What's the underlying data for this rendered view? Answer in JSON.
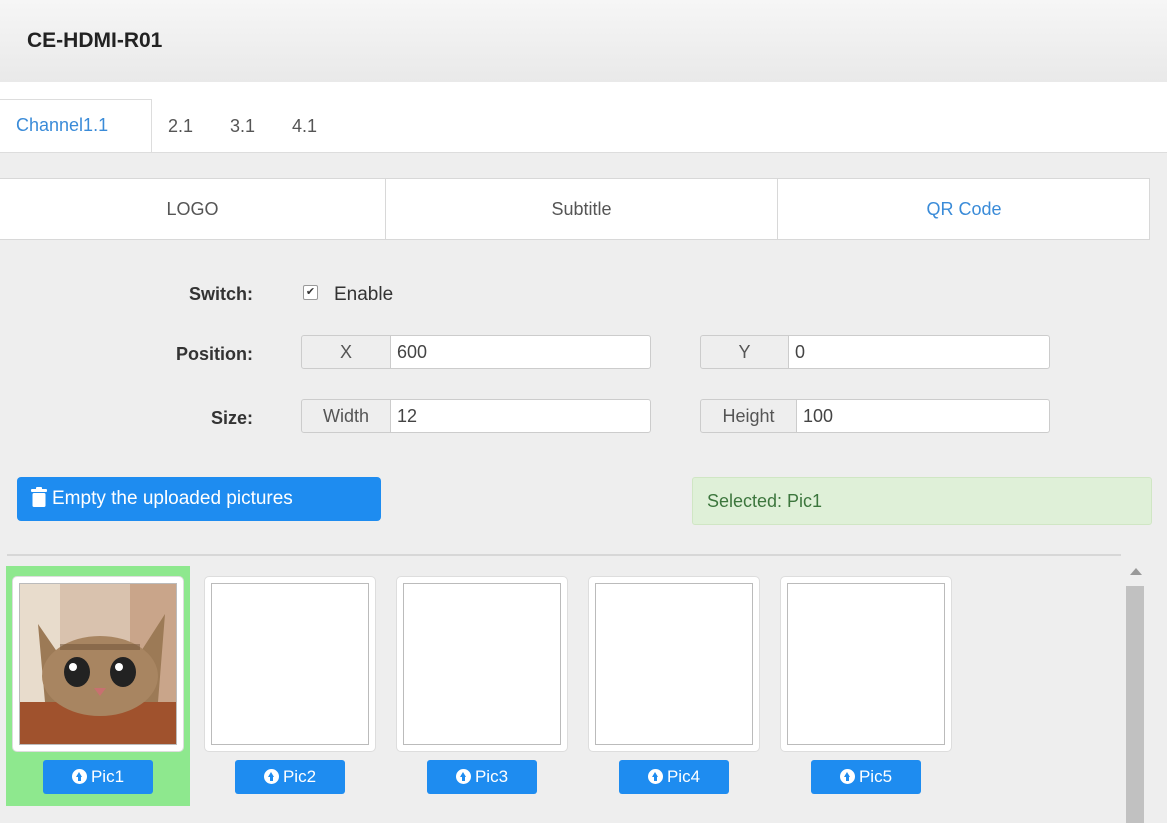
{
  "app": {
    "title": "CE-HDMI-R01"
  },
  "channel_tabs": [
    {
      "label": "Channel1.1",
      "active": true
    },
    {
      "label": "2.1",
      "active": false
    },
    {
      "label": "3.1",
      "active": false
    },
    {
      "label": "4.1",
      "active": false
    }
  ],
  "sub_tabs": [
    {
      "label": "LOGO"
    },
    {
      "label": "Subtitle"
    },
    {
      "label": "QR Code",
      "active": true
    }
  ],
  "form": {
    "switch_label": "Switch:",
    "enable_label": "Enable",
    "enable_checked": true,
    "position_label": "Position:",
    "x_addon": "X",
    "x_value": "600",
    "y_addon": "Y",
    "y_value": "0",
    "size_label": "Size:",
    "width_addon": "Width",
    "width_value": "12",
    "height_addon": "Height",
    "height_value": "100"
  },
  "actions": {
    "empty_label": "Empty the uploaded pictures"
  },
  "status": {
    "selected_text": "Selected: Pic1"
  },
  "pictures": [
    {
      "label": "Pic1",
      "selected": true,
      "has_image": true
    },
    {
      "label": "Pic2",
      "selected": false,
      "has_image": false
    },
    {
      "label": "Pic3",
      "selected": false,
      "has_image": false
    },
    {
      "label": "Pic4",
      "selected": false,
      "has_image": false
    },
    {
      "label": "Pic5",
      "selected": false,
      "has_image": false
    }
  ],
  "colors": {
    "accent": "#1e8cf0",
    "selected_bg": "#8ee88e",
    "success_bg": "#dff0d8"
  }
}
